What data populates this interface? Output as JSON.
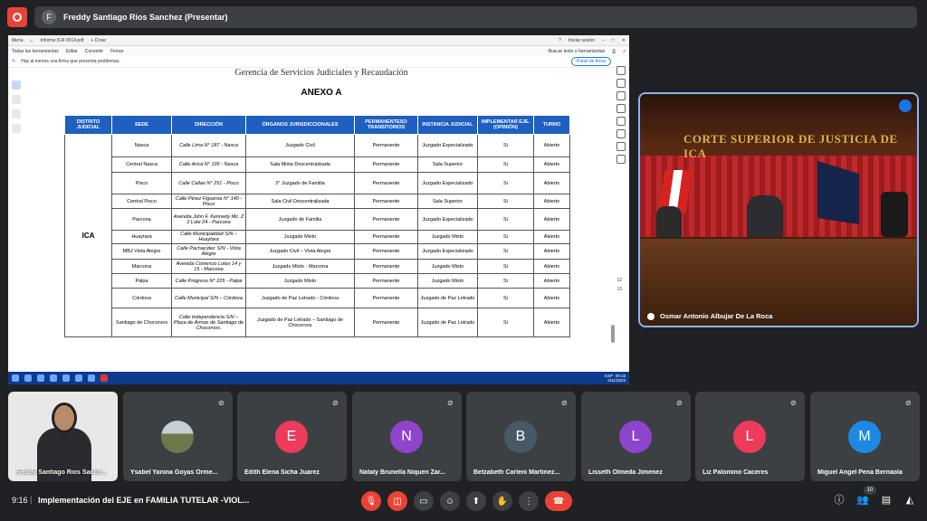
{
  "presenter_bar": {
    "avatar_letter": "F",
    "text": "Freddy Santiago Rios Sanchez (Presentar)"
  },
  "shared_screen": {
    "acrobat": {
      "tabs": [
        "Menú",
        "Informe ICA V014.pdf",
        "+ Crear"
      ],
      "signin": "Iniciar sesión",
      "menu": [
        "Todas las herramientas",
        "Editar",
        "Convertir",
        "Firmar"
      ],
      "search": "Buscar texto o herramientas",
      "warning": "Hay al menos una firma que presenta problemas.",
      "panel_button": "Panel de firma",
      "page_numbers": [
        "12",
        "13"
      ]
    },
    "document": {
      "header": "Gerencia de Servicios Judiciales y Recaudación",
      "anexo": "ANEXO A",
      "columns": [
        "DISTRITO JUDICIAL",
        "SEDE",
        "DIRECCIÓN",
        "ÓRGANOS JURISDICCIONALES",
        "PERMANENTESO TRANSITORIOS",
        "INSTANCIA JUDICIAL",
        "IMPLEMENTAR EJE. (OPINIÓN)",
        "TURNO"
      ],
      "district": "ICA",
      "rows": [
        {
          "sede": "Nasca",
          "direccion": "Calle Lima N° 187 - Nasca",
          "organo": "Juzgado Civil",
          "perm": "Permanente",
          "instancia": "Juzgado Especializado",
          "impl": "Si",
          "turno": "Abierto"
        },
        {
          "sede": "Central Nasca",
          "direccion": "Calle Arica N° 195 - Nasca",
          "organo": "Sala Mixta Descentralizada",
          "perm": "Permanente",
          "instancia": "Sala Superior",
          "impl": "Si",
          "turno": "Abierto"
        },
        {
          "sede": "Pisco",
          "direccion": "Calle Callao N° 251 - Pisco",
          "organo": "2° Juzgado de Familia",
          "perm": "Permanente",
          "instancia": "Juzgado Especializado",
          "impl": "Si",
          "turno": "Abierto"
        },
        {
          "sede": "Central Pisco",
          "direccion": "Calle Pérez Figueroa N° 140 - Pisco",
          "organo": "Sala Civil Descentralizada",
          "perm": "Permanente",
          "instancia": "Sala Superior",
          "impl": "Si",
          "turno": "Abierto"
        },
        {
          "sede": "Parcona",
          "direccion": "Avenida John F. Kennedy Mz. Z 2 Lote 24 - Parcona",
          "organo": "Juzgado de Familia",
          "perm": "Permanente",
          "instancia": "Juzgado Especializado",
          "impl": "Si",
          "turno": "Abierto"
        },
        {
          "sede": "Huaytara",
          "direccion": "Calle Municipalidad S/N – Huaytara",
          "organo": "Juzgado Mixto",
          "perm": "Permanente",
          "instancia": "Juzgado Mixto",
          "impl": "Si",
          "turno": "Abierto"
        },
        {
          "sede": "MBJ Vista Alegre",
          "direccion": "Calle Pachacútec S/N - Vista Alegre",
          "organo": "Juzgado Civil – Vista Alegre",
          "perm": "Permanente",
          "instancia": "Juzgado Especializado",
          "impl": "Si",
          "turno": "Abierto"
        },
        {
          "sede": "Marcona",
          "direccion": "Avenida Comercio Lotes 14 y 15 - Marcona",
          "organo": "Juzgado Mixto - Marcona",
          "perm": "Permanente",
          "instancia": "Juzgado Mixto",
          "impl": "Si",
          "turno": "Abierto"
        },
        {
          "sede": "Palpa",
          "direccion": "Calle Progreso N° 225 - Palpa",
          "organo": "Juzgado Mixto",
          "perm": "Permanente",
          "instancia": "Juzgado Mixto",
          "impl": "Si",
          "turno": "Abierto"
        },
        {
          "sede": "Córdova",
          "direccion": "Calle Municipal S/N – Córdova",
          "organo": "Juzgado de Paz Letrado - Córdova",
          "perm": "Permanente",
          "instancia": "Juzgado de Paz Letrado",
          "impl": "Si",
          "turno": "Abierto"
        },
        {
          "sede": "Santiago de Chocorvos",
          "direccion": "Calle Independencia S/N – Plaza de Armas de Santiago de Chocorvos.",
          "organo": "Juzgado de Paz Letrado – Santiago de Chocorvos",
          "perm": "Permanente",
          "instancia": "Juzgado de Paz Letrado",
          "impl": "Si",
          "turno": "Abierto"
        }
      ]
    },
    "taskbar": {
      "lang": "ESP",
      "time": "09:15",
      "date": "3/11/2023"
    }
  },
  "speaker": {
    "wall_text": "CORTE SUPERIOR DE JUSTICIA DE ICA",
    "name": "Osmar Antonio Albujar De La Roca"
  },
  "participants": [
    {
      "name": "Freddy Santiago Rios Sanch...",
      "type": "video"
    },
    {
      "name": "Ysabel Yanina Goyas Orme...",
      "type": "image",
      "color": "#5f6368"
    },
    {
      "name": "Edith Elena Sicha Juarez",
      "letter": "E",
      "color": "#ec3b5b"
    },
    {
      "name": "Nataly Brunella Niquen Zar...",
      "letter": "N",
      "color": "#8e44cc"
    },
    {
      "name": "Betzabeth Carleni Martinez...",
      "letter": "B",
      "color": "#455a64"
    },
    {
      "name": "Lisseth Olmeda Jimenez",
      "letter": "L",
      "color": "#8e44cc"
    },
    {
      "name": "Liz Palomino Caceres",
      "letter": "L",
      "color": "#ec3b5b"
    },
    {
      "name": "Miguel Angel Pena Bernaola",
      "letter": "M",
      "color": "#1e88e5"
    }
  ],
  "bottom_bar": {
    "time": "9:16",
    "separator": "|",
    "meeting_title": "Implementación del EJE en FAMILIA TUTELAR -VIOL...",
    "participant_count": "10"
  }
}
